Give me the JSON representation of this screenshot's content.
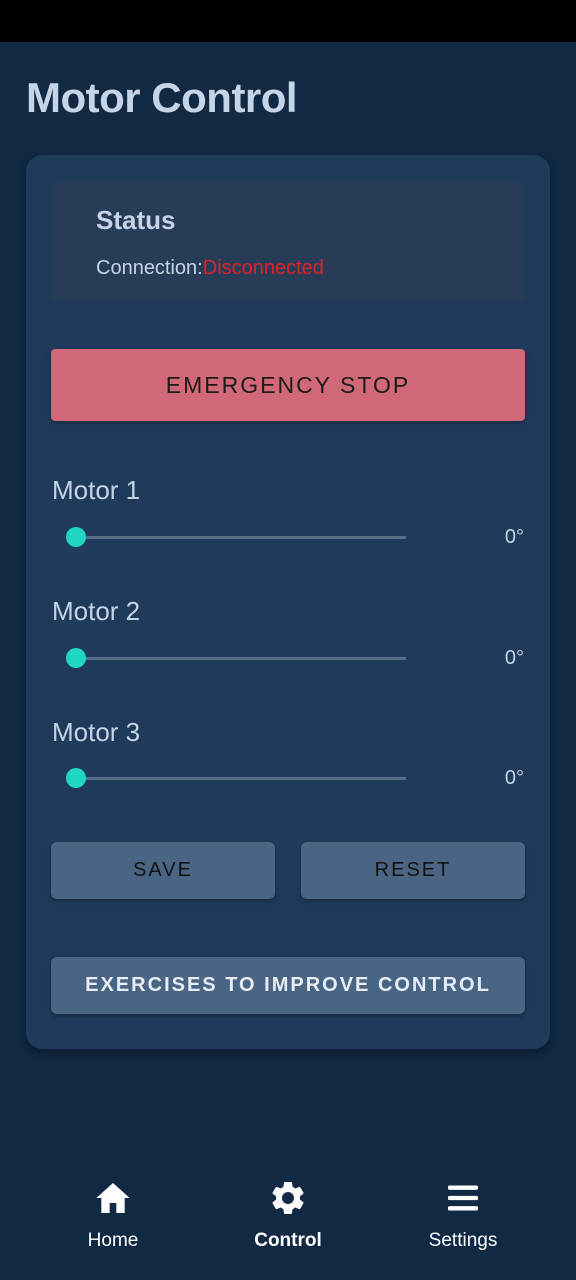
{
  "page": {
    "title": "Motor Control"
  },
  "status": {
    "heading": "Status",
    "connection_label": "Connection:",
    "connection_value": "Disconnected",
    "connection_color": "#e0202a"
  },
  "emergency_stop": {
    "label": "EMERGENCY STOP",
    "color": "#d06878"
  },
  "motors": [
    {
      "label": "Motor 1",
      "value_text": "0°",
      "value": 0
    },
    {
      "label": "Motor 2",
      "value_text": "0°",
      "value": 0
    },
    {
      "label": "Motor 3",
      "value_text": "0°",
      "value": 0
    }
  ],
  "actions": {
    "save_label": "SAVE",
    "reset_label": "RESET",
    "exercises_label": "EXERCISES TO IMPROVE CONTROL"
  },
  "bottom_nav": {
    "items": [
      {
        "label": "Home",
        "icon": "home-icon",
        "active": false
      },
      {
        "label": "Control",
        "icon": "gear-icon",
        "active": true
      },
      {
        "label": "Settings",
        "icon": "menu-icon",
        "active": false
      }
    ]
  },
  "colors": {
    "background": "#122944",
    "card": "#1f3a5a",
    "accent": "#1fd6c4",
    "button": "#4a6583"
  }
}
